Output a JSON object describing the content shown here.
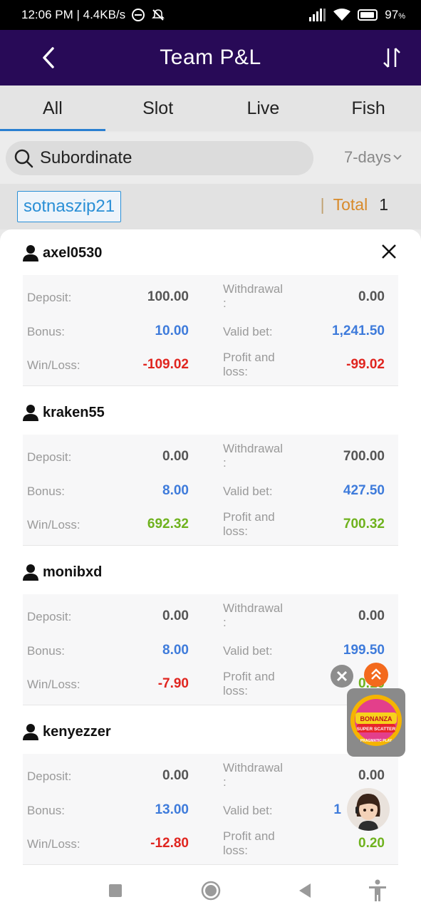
{
  "status_bar": {
    "time_speed": "12:06 PM | 4.4KB/s",
    "battery": "97"
  },
  "header": {
    "title": "Team P&L"
  },
  "tabs": [
    {
      "label": "All"
    },
    {
      "label": "Slot"
    },
    {
      "label": "Live"
    },
    {
      "label": "Fish"
    }
  ],
  "search": {
    "label": "Subordinate",
    "range": "7-days"
  },
  "account": {
    "tag": "sotnaszip21",
    "total_label": "Total",
    "total_value": "1"
  },
  "labels": {
    "deposit": "Deposit:",
    "withdrawal": "Withdrawal",
    "withdrawal_colon": ":",
    "bonus": "Bonus:",
    "valid_bet": "Valid bet:",
    "winloss": "Win/Loss:",
    "pnl_line1": "Profit and",
    "pnl_line2": "loss:"
  },
  "members": [
    {
      "name": "axel0530",
      "deposit": "100.00",
      "withdrawal": "0.00",
      "bonus": "10.00",
      "valid_bet": "1,241.50",
      "winloss": "-109.02",
      "pnl": "-99.02"
    },
    {
      "name": "kraken55",
      "deposit": "0.00",
      "withdrawal": "700.00",
      "bonus": "8.00",
      "valid_bet": "427.50",
      "winloss": "692.32",
      "pnl": "700.32"
    },
    {
      "name": "monibxd",
      "deposit": "0.00",
      "withdrawal": "0.00",
      "bonus": "8.00",
      "valid_bet": "199.50",
      "winloss": "-7.90",
      "pnl": "0.10"
    },
    {
      "name": "kenyezzer",
      "deposit": "0.00",
      "withdrawal": "0.00",
      "bonus": "13.00",
      "valid_bet": "1",
      "winloss": "-12.80",
      "pnl": "0.20"
    }
  ],
  "colors": {
    "header_bg": "#280a57",
    "tab_indicator": "#2a7fd1",
    "positive": "#6fb21e",
    "negative": "#e0251f",
    "blue": "#3e7bdb",
    "total_label": "#d88a2a"
  },
  "promo": {
    "line1": "BONANZA",
    "line2": "SUPER SCATTER",
    "line3": "PRAGMATIC PLAY"
  }
}
